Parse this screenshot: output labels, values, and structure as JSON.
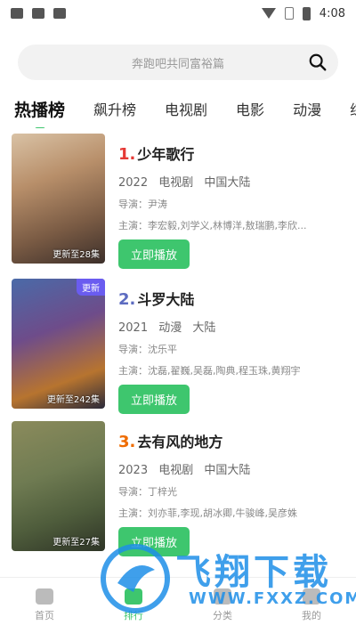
{
  "status_bar": {
    "time": "4:08"
  },
  "search": {
    "placeholder": "奔跑吧共同富裕篇"
  },
  "tabs": [
    "热播榜",
    "飙升榜",
    "电视剧",
    "电影",
    "动漫",
    "综"
  ],
  "items": [
    {
      "rank": "1.",
      "title": "少年歌行",
      "year": "2022",
      "category": "电视剧",
      "region": "中国大陆",
      "director": "导演：尹涛",
      "cast": "主演：李宏毅,刘学义,林博洋,敖瑞鹏,李欣...",
      "update": "更新至28集",
      "badge": "",
      "play": "立即播放",
      "rank_color": "#e53935"
    },
    {
      "rank": "2.",
      "title": "斗罗大陆",
      "year": "2021",
      "category": "动漫",
      "region": "大陆",
      "director": "导演：沈乐平",
      "cast": "主演：沈磊,翟巍,吴磊,陶典,程玉珠,黄翔宇",
      "update": "更新至242集",
      "badge": "更新",
      "play": "立即播放",
      "rank_color": "#5c6bc0"
    },
    {
      "rank": "3.",
      "title": "去有风的地方",
      "year": "2023",
      "category": "电视剧",
      "region": "中国大陆",
      "director": "导演：丁梓光",
      "cast": "主演：刘亦菲,李现,胡冰卿,牛骏峰,吴彦姝",
      "update": "更新至27集",
      "badge": "",
      "play": "立即播放",
      "rank_color": "#ef6c00"
    }
  ],
  "bottom_nav": [
    "首页",
    "排行",
    "分类",
    "我的"
  ],
  "watermark": {
    "title": "飞翔下载",
    "sub": "WWW.FXXZ.COM"
  }
}
